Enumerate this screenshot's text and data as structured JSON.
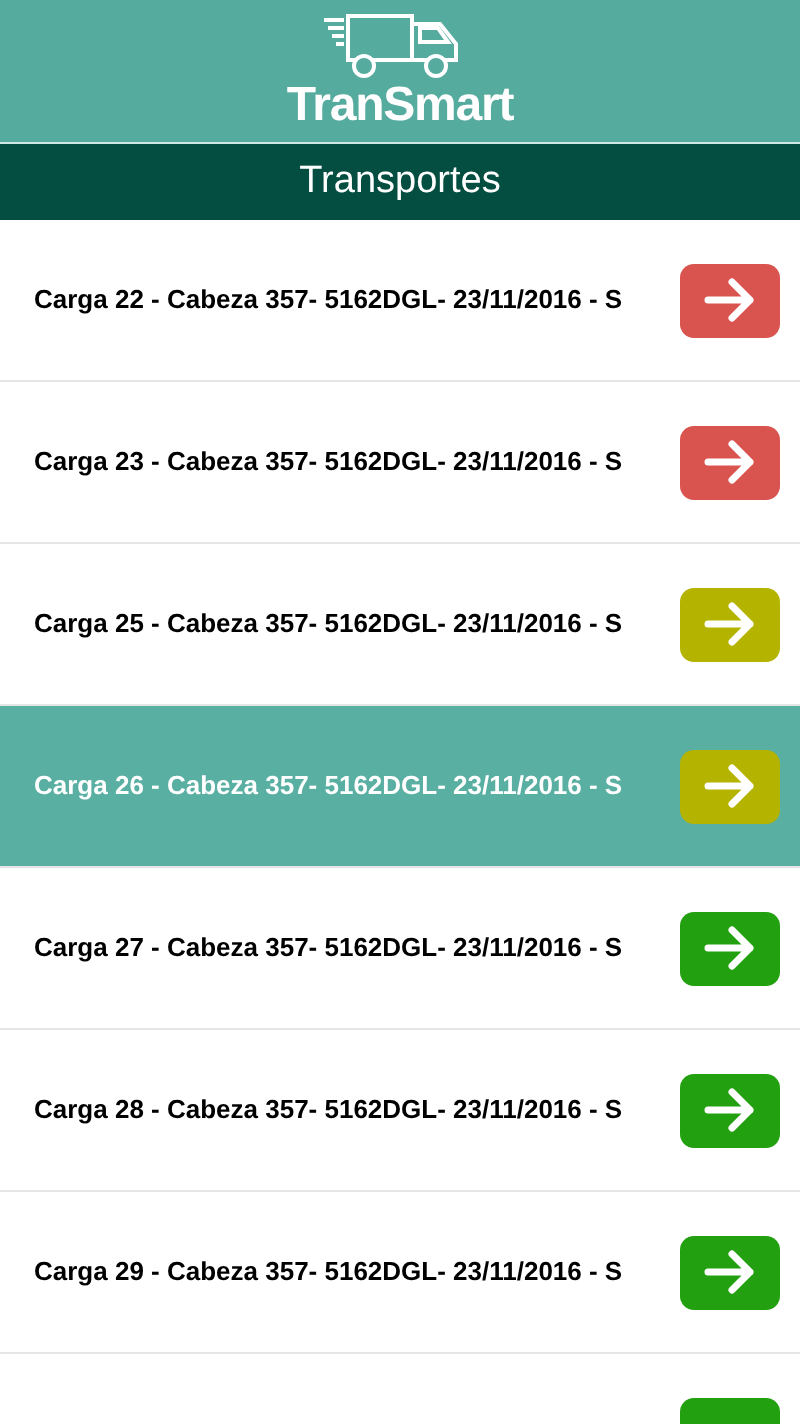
{
  "header": {
    "logo_text": "TranSmart"
  },
  "title": "Transportes",
  "rows": [
    {
      "label": "Carga 22 - Cabeza 357- 5162DGL- 23/11/2016 - S",
      "selected": false,
      "color": "#d9534f"
    },
    {
      "label": "Carga 23 - Cabeza 357- 5162DGL- 23/11/2016 - S",
      "selected": false,
      "color": "#d9534f"
    },
    {
      "label": "Carga 25 - Cabeza 357- 5162DGL- 23/11/2016 - S",
      "selected": false,
      "color": "#b3b300"
    },
    {
      "label": "Carga 26 - Cabeza 357- 5162DGL- 23/11/2016 - S",
      "selected": true,
      "color": "#b3b300"
    },
    {
      "label": "Carga 27 - Cabeza 357- 5162DGL- 23/11/2016 - S",
      "selected": false,
      "color": "#22a010"
    },
    {
      "label": "Carga 28 - Cabeza 357- 5162DGL- 23/11/2016 - S",
      "selected": false,
      "color": "#22a010"
    },
    {
      "label": "Carga 29 - Cabeza 357- 5162DGL- 23/11/2016 - S",
      "selected": false,
      "color": "#22a010"
    },
    {
      "selected": false,
      "color": "#22a010"
    }
  ]
}
